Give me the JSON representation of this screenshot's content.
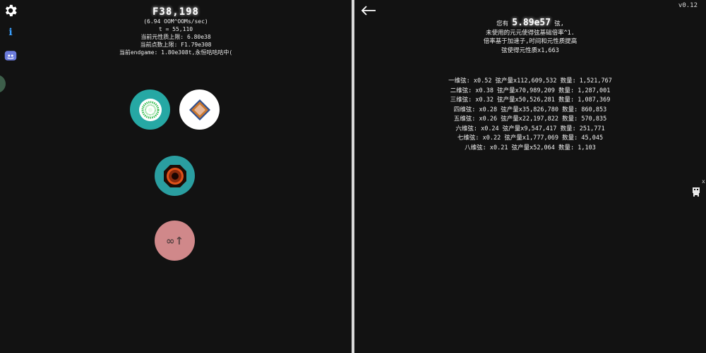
{
  "version": "v0.12",
  "left": {
    "currency": "F38,198",
    "rate": "(6.94 OOM^OOMs/sec)",
    "time": "t = 55,110",
    "lines": [
      "当前元性质上限: 6.80e38",
      "当前点数上限: F1.79e308",
      "当前endgame: 1.80e308t,永恒咕咕咕中("
    ],
    "infinity_label": "∞↑"
  },
  "icons": {
    "settings": "gear-icon",
    "info": "info-icon",
    "discord": "discord-icon",
    "back": "back-arrow-icon",
    "info_glyph": "i"
  },
  "right": {
    "have_prefix": "您有 ",
    "strings_amount": "5.89e57",
    "have_suffix": " 弦,",
    "line2": "未使用的元元使得弦基础倍率^1.",
    "line3": "倍率基于加速子,时间和元性质提高",
    "line4": "弦使得元性质x1,663",
    "rows": [
      "一维弦: x0.52 弦产量x112,609,532 数量: 1,521,767",
      "二维弦: x0.38 弦产量x70,989,209 数量: 1,287,001",
      "三维弦: x0.32 弦产量x50,526,281 数量: 1,087,369",
      "四维弦: x0.28 弦产量x35,826,780 数量: 860,853",
      "五维弦: x0.26 弦产量x22,197,822 数量: 570,835",
      "六维弦: x0.24 弦产量x9,547,417 数量: 251,771",
      "七维弦: x0.22 弦产量x1,777,069 数量: 45,045",
      "八维弦: x0.21 弦产量x52,064 数量: 1,103"
    ]
  },
  "edge_mark": "x",
  "colors": {
    "background": "#121212",
    "divider": "#d9d9d9",
    "teal": "#26a8a4",
    "pink": "#d0888a"
  }
}
